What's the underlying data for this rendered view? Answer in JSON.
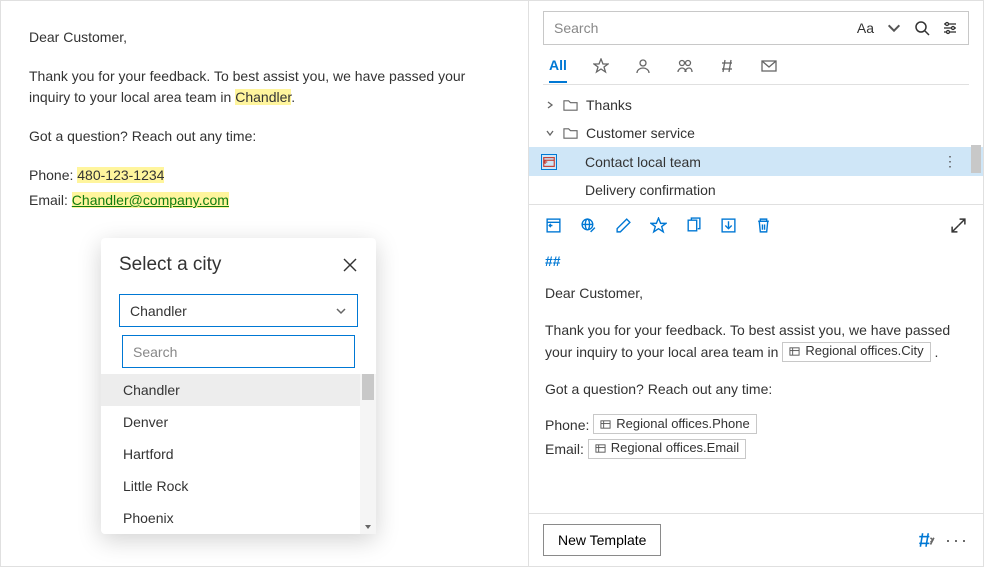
{
  "email": {
    "greeting": "Dear Customer,",
    "body1a": "Thank you for your feedback. To best assist you, we have passed your inquiry to your local area team in ",
    "body1_hl": "Chandler",
    "body1b": ".",
    "body2": "Got a question? Reach out any time:",
    "phone_label": "Phone: ",
    "phone_hl": "480-123-1234",
    "email_label": "Email: ",
    "email_link": "Chandler@company.com"
  },
  "popup": {
    "title": "Select a city",
    "selected": "Chandler",
    "search_placeholder": "Search",
    "options": [
      "Chandler",
      "Denver",
      "Hartford",
      "Little Rock",
      "Phoenix"
    ]
  },
  "search": {
    "placeholder": "Search",
    "font_label": "Aa"
  },
  "filters": {
    "all": "All"
  },
  "tree": {
    "folder1": "Thanks",
    "folder2": "Customer service",
    "item1": "Contact local team",
    "item2": "Delivery confirmation"
  },
  "preview": {
    "hash": "##",
    "greeting": "Dear Customer,",
    "p1a": "Thank you for your feedback. To best assist you, we have passed your inquiry to your local area team in ",
    "token_city": "Regional offices.City",
    "p1b": " .",
    "p2": "Got a question? Reach out any time:",
    "phone_label": "Phone: ",
    "token_phone": "Regional offices.Phone",
    "email_label": "Email: ",
    "token_email": "Regional offices.Email"
  },
  "footer": {
    "new_template": "New Template"
  }
}
